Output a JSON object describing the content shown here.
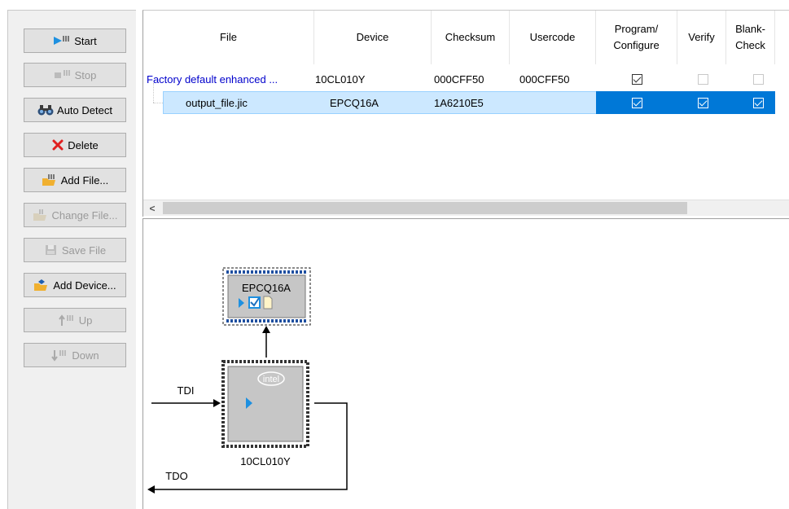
{
  "toolbar": {
    "buttons": [
      {
        "label": "Start",
        "icon": "start-icon",
        "enabled": true
      },
      {
        "label": "Stop",
        "icon": "stop-icon",
        "enabled": false
      },
      {
        "label": "Auto Detect",
        "icon": "binoculars-icon",
        "enabled": true
      },
      {
        "label": "Delete",
        "icon": "delete-x-icon",
        "enabled": true
      },
      {
        "label": "Add File...",
        "icon": "add-file-icon",
        "enabled": true
      },
      {
        "label": "Change File...",
        "icon": "change-file-icon",
        "enabled": false
      },
      {
        "label": "Save File",
        "icon": "save-file-icon",
        "enabled": false
      },
      {
        "label": "Add Device...",
        "icon": "add-device-icon",
        "enabled": true
      },
      {
        "label": "Up",
        "icon": "up-icon",
        "enabled": false
      },
      {
        "label": "Down",
        "icon": "down-icon",
        "enabled": false
      }
    ]
  },
  "table": {
    "columns": [
      "File",
      "Device",
      "Checksum",
      "Usercode",
      "Program/ Configure",
      "Verify",
      "Blank- Check"
    ],
    "rows": [
      {
        "file": "Factory default enhanced ...",
        "device": "10CL010Y",
        "checksum": "000CFF50",
        "usercode": "000CFF50",
        "program": true,
        "verify": false,
        "blank": false,
        "selected": false
      },
      {
        "file": "output_file.jic",
        "device": "EPCQ16A",
        "checksum": "1A6210E5",
        "usercode": "",
        "program": true,
        "verify": true,
        "blank": true,
        "selected": true
      }
    ],
    "scroll_left_glyph": "<"
  },
  "chain": {
    "flash_label": "EPCQ16A",
    "fpga_label": "10CL010Y",
    "fpga_logo": "intel",
    "tdi": "TDI",
    "tdo": "TDO"
  },
  "colors": {
    "selection_light": "#cce8ff",
    "selection_dark": "#0078d7",
    "link_blue": "#0000cc",
    "accent_arrow": "#1e90e0"
  }
}
